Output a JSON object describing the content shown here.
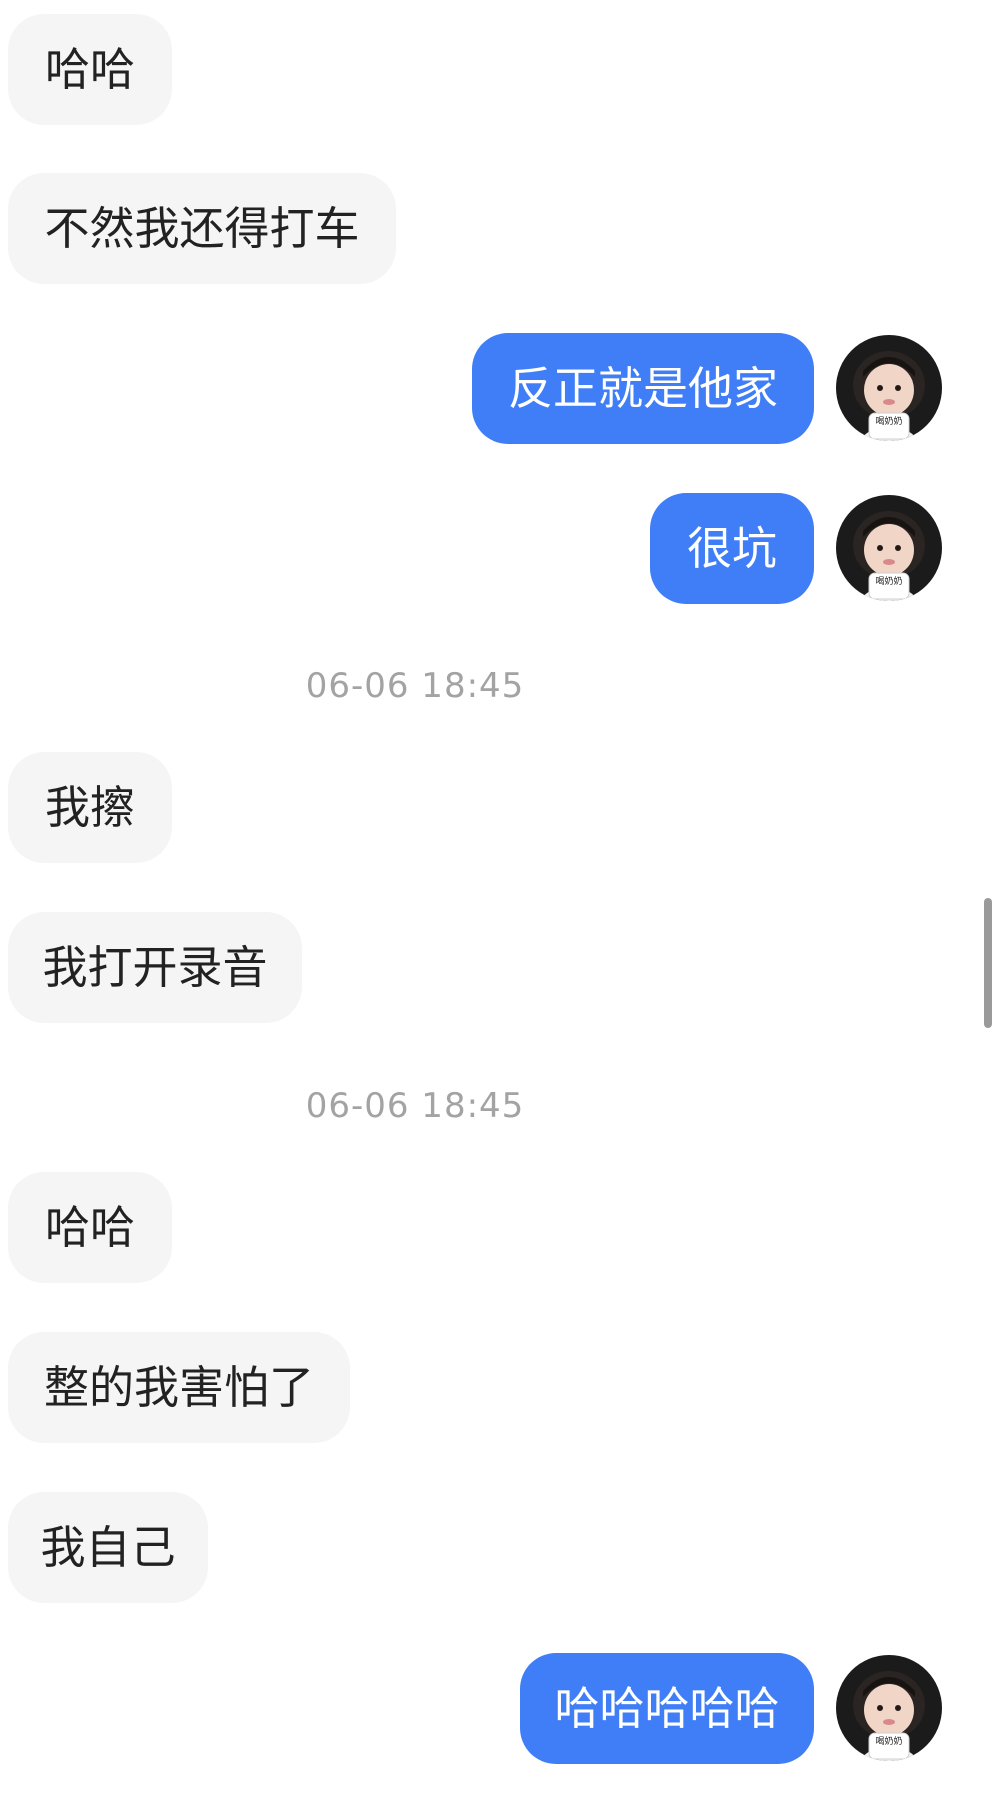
{
  "messages": [
    {
      "side": "in",
      "text": "哈哈"
    },
    {
      "side": "in",
      "text": "不然我还得打车"
    },
    {
      "side": "out",
      "text": "反正就是他家"
    },
    {
      "side": "out",
      "text": "很坑"
    },
    {
      "side": "time",
      "text": "06-06 18:45"
    },
    {
      "side": "in",
      "text": "我擦"
    },
    {
      "side": "in",
      "text": "我打开录音"
    },
    {
      "side": "time",
      "text": "06-06 18:45"
    },
    {
      "side": "in",
      "text": "哈哈"
    },
    {
      "side": "in",
      "text": "整的我害怕了"
    },
    {
      "side": "in",
      "text": "我自己"
    },
    {
      "side": "out",
      "text": "哈哈哈哈哈"
    }
  ],
  "avatar": {
    "cup_label": "喝奶奶"
  },
  "colors": {
    "incoming_bubble": "#f5f5f5",
    "outgoing_bubble": "#3f7ef7",
    "timestamp_text": "#a3a3a3",
    "background": "#ffffff"
  }
}
